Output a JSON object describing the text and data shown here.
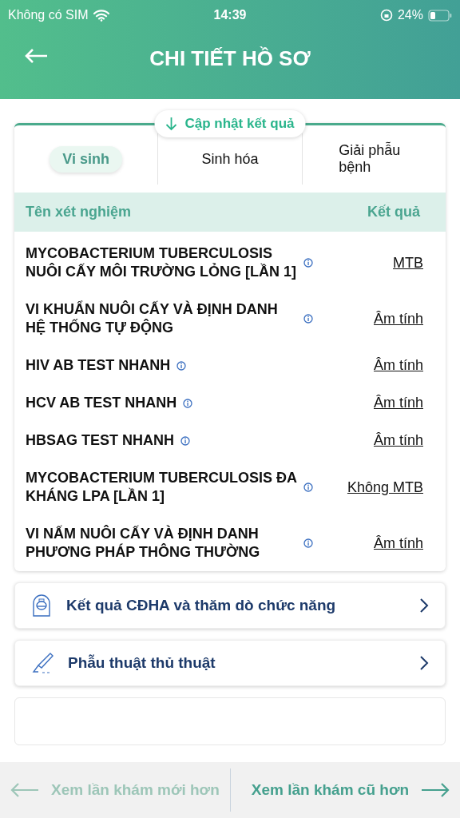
{
  "status_bar": {
    "carrier": "Không có SIM",
    "time": "14:39",
    "battery": "24%"
  },
  "header": {
    "title": "CHI TIẾT HỒ SƠ"
  },
  "update_button": {
    "label": "Cập nhật kết quả"
  },
  "tabs": [
    {
      "label": "Vi sinh",
      "selected": true
    },
    {
      "label": "Sinh hóa",
      "selected": false
    },
    {
      "label": "Giải phẫu bệnh",
      "selected": false
    }
  ],
  "table": {
    "columns": [
      "Tên xét nghiệm",
      "Kết quả"
    ],
    "rows": [
      {
        "name": "MYCOBACTERIUM TUBERCULOSIS NUÔI CẤY MÔI TRƯỜNG LỎNG [LẦN 1]",
        "result": "MTB"
      },
      {
        "name": "VI KHUẨN NUÔI CẤY VÀ ĐỊNH DANH HỆ THỐNG TỰ ĐỘNG",
        "result": "Âm tính"
      },
      {
        "name": "HIV AB TEST NHANH",
        "result": "Âm tính"
      },
      {
        "name": "HCV AB TEST NHANH",
        "result": "Âm tính"
      },
      {
        "name": "HBSAG TEST NHANH",
        "result": "Âm tính"
      },
      {
        "name": "MYCOBACTERIUM TUBERCULOSIS ĐA KHÁNG LPA [LẦN 1]",
        "result": "Không MTB"
      },
      {
        "name": "VI NẤM NUÔI CẤY VÀ ĐỊNH DANH PHƯƠNG PHÁP THÔNG THƯỜNG",
        "result": "Âm tính"
      }
    ]
  },
  "sections": [
    {
      "label": "Kết quả CĐHA và thăm dò chức năng",
      "kind": "imaging"
    },
    {
      "label": "Phẫu thuật thủ thuật",
      "kind": "surgery"
    }
  ],
  "bottom_nav": {
    "previous": {
      "label": "Xem lần khám mới hơn",
      "disabled": true
    },
    "next": {
      "label": "Xem lần khám cũ hơn",
      "disabled": false
    }
  }
}
